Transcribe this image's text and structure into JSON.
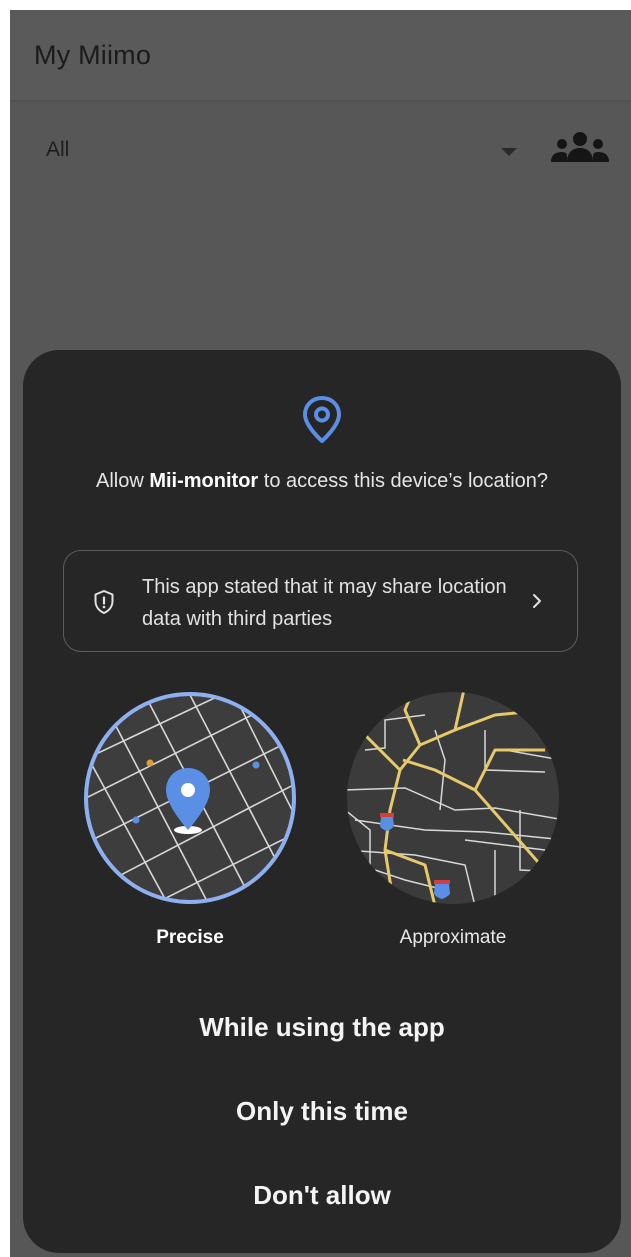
{
  "app_bar": {
    "title": "My Miimo"
  },
  "filter": {
    "selected": "All",
    "dropdown_icon": "dropdown-arrow-icon",
    "group_icon": "group-icon"
  },
  "permission_dialog": {
    "icon": "location-pin-icon",
    "prompt_before": "Allow ",
    "app_name": "Mii-monitor",
    "prompt_after": " to access this device’s location?",
    "share_notice": {
      "icon": "shield-alert-icon",
      "text": "This app stated that it may share location data with third parties",
      "chevron_icon": "chevron-right-icon"
    },
    "accuracy_options": [
      {
        "label": "Precise",
        "selected": true
      },
      {
        "label": "Approximate",
        "selected": false
      }
    ],
    "buttons": {
      "while_using": "While using the app",
      "only_this_time": "Only this time",
      "dont_allow": "Don't allow"
    }
  },
  "colors": {
    "scrim_background": "#575757",
    "sheet_background": "#262626",
    "accent_blue": "#5b8fe6",
    "map_road_yellow": "#e6c96b"
  }
}
